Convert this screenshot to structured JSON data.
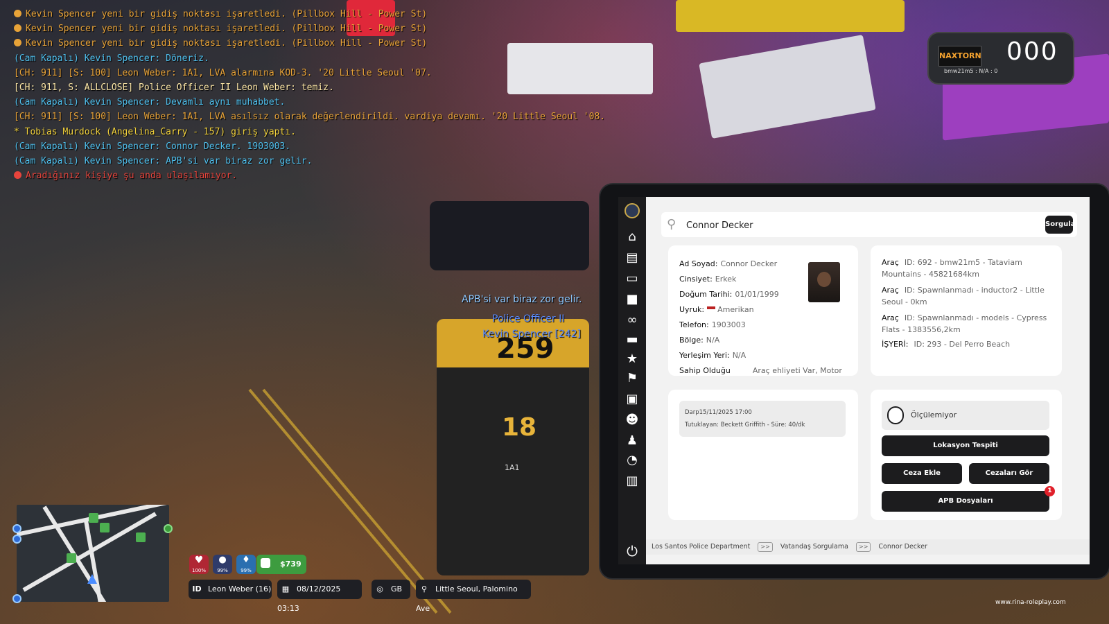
{
  "chat": [
    {
      "icon": "info-dot",
      "color": "#e8a338",
      "text": "Kevin Spencer yeni bir gidiş noktası işaretledi. (Pillbox Hill - Power St)"
    },
    {
      "icon": "info-dot",
      "color": "#e8a338",
      "text": "Kevin Spencer yeni bir gidiş noktası işaretledi. (Pillbox Hill - Power St)"
    },
    {
      "icon": "info-dot",
      "color": "#e8a338",
      "text": "Kevin Spencer yeni bir gidiş noktası işaretledi. (Pillbox Hill - Power St)"
    },
    {
      "icon": "",
      "color": "#4fc0ee",
      "text": "(Cam Kapalı) Kevin Spencer: Döneriz."
    },
    {
      "icon": "",
      "color": "#e8a338",
      "text": "[CH: 911] [S: 100] Leon Weber: 1A1, LVA alarmına KOD-3. '20 Little Seoul '07."
    },
    {
      "icon": "",
      "color": "#ffe9a8",
      "text": "[CH: 911, S: ALLCLOSE] Police Officer II Leon Weber: temiz."
    },
    {
      "icon": "",
      "color": "#4fc0ee",
      "text": "(Cam Kapalı) Kevin Spencer: Devamlı aynı muhabbet."
    },
    {
      "icon": "",
      "color": "#e8a338",
      "text": "[CH: 911] [S: 100] Leon Weber: 1A1, LVA asılsız olarak değerlendirildi. vardiya devamı. '20 Little Seoul '08."
    },
    {
      "icon": "",
      "color": "#f2d23c",
      "text": "* Tobias Murdock (Angelina_Carry - 157) giriş yaptı."
    },
    {
      "icon": "",
      "color": "#4fc0ee",
      "text": "(Cam Kapalı) Kevin Spencer: Connor Decker. 1903003."
    },
    {
      "icon": "",
      "color": "#4fc0ee",
      "text": "(Cam Kapalı) Kevin Spencer: APB'si var biraz zor gelir."
    },
    {
      "icon": "error-dot",
      "color": "#e8443c",
      "text": "Aradığınız kişiye şu anda ulaşılamıyor."
    }
  ],
  "world": {
    "speech_bubble": "APB'si var biraz zor gelir.",
    "player_rank": "Police Officer II",
    "player_name": "Kevin Spencer [242]",
    "car_number": "259",
    "car_number2": "18",
    "unit": "1A1"
  },
  "speedometer": {
    "brand": "NAXTORN",
    "speed": "000",
    "sub": "bmw21m5 : N/A : 0"
  },
  "mdt": {
    "search": {
      "value": "Connor Decker",
      "button": "Sorgula"
    },
    "person": {
      "name_label": "Ad Soyad:",
      "name": "Connor Decker",
      "gender_label": "Cinsiyet:",
      "gender": "Erkek",
      "dob_label": "Doğum Tarihi:",
      "dob": "01/01/1999",
      "nation_label": "Uyruk:",
      "nation": "Amerikan",
      "phone_label": "Telefon:",
      "phone": "1903003",
      "region_label": "Bölge:",
      "region": "N/A",
      "residence_label": "Yerleşim Yeri:",
      "residence": "N/A",
      "license_label": "Sahip Olduğu",
      "license": "Araç ehliyeti Var, Motor"
    },
    "vehicles": [
      {
        "label": "Araç",
        "value": "ID: 692 - bmw21m5 - Tataviam Mountains - 45821684km"
      },
      {
        "label": "Araç",
        "value": "ID: Spawnlanmadı - inductor2 - Little Seoul - 0km"
      },
      {
        "label": "Araç",
        "value": "ID: Spawnlanmadı - models - Cypress Flats - 1383556,2km"
      },
      {
        "label": "İŞYERİ:",
        "value": "ID: 293 - Del Perro Beach"
      }
    ],
    "record": {
      "line1": "Darp15/11/2025 17:00",
      "line2": "Tutuklayan: Beckett Griffith - Süre: 40/dk"
    },
    "gps_status": "Ölçülemiyor",
    "buttons": {
      "locate": "Lokasyon Tespiti",
      "add_fine": "Ceza Ekle",
      "view_fines": "Cezaları Gör",
      "apb": "APB Dosyaları",
      "apb_badge": "1"
    },
    "breadcrumb": [
      "Los Santos Police Department",
      "Vatandaş Sorgulama",
      "Connor Decker"
    ],
    "breadcrumb_sep": ">>"
  },
  "hud": {
    "health": "100%",
    "hunger": "99%",
    "thirst": "99%",
    "money": "$739",
    "id_label": "ID",
    "player": "Leon Weber (16)",
    "datetime": "08/12/2025 03:13",
    "compass": "GB",
    "location": "Little Seoul, Palomino Ave",
    "watermark": "www.rina-roleplay.com"
  },
  "colors": {
    "accent_dark": "#1c1c1e",
    "badge_red": "#e0202a",
    "money_green": "#3d9c3f"
  }
}
